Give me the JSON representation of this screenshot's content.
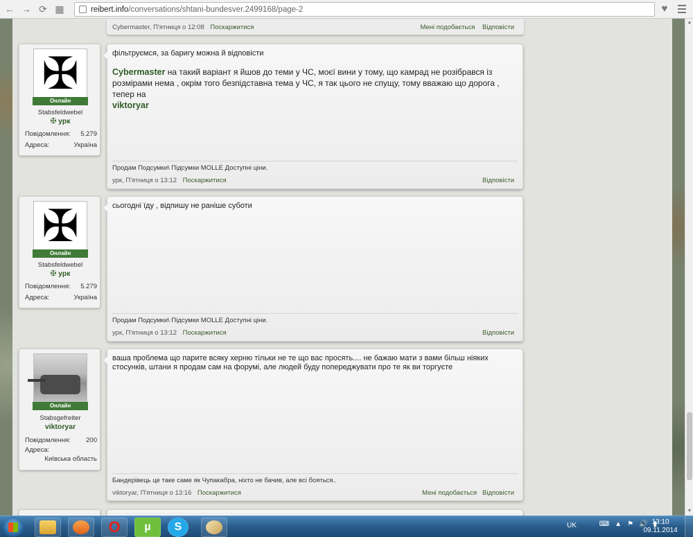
{
  "browser": {
    "back": "←",
    "forward": "→",
    "reload": "⟳",
    "apps": "▦",
    "url_host": "reibert.info",
    "url_path": "/conversations/shtani-bundesver.2499168/page-2",
    "star": "♥",
    "colors": {
      "toolbar": "#f1f1f1",
      "accent_green": "#3f7a36"
    }
  },
  "prev_footer": {
    "meta": "Cybermaster, П'ятниця о 12:08",
    "report": "Поскаржитися",
    "like": "Мені подобається",
    "reply": "Відповісти"
  },
  "messages": [
    {
      "user": {
        "avatar": "iron-cross",
        "online": "Онлайн",
        "rank": "Stabsfeldwebel",
        "name": "урк",
        "name_icon": "✠",
        "stats": [
          {
            "label": "Повідомлення:",
            "value": "5.279"
          },
          {
            "label": "Адреса:",
            "value": "Україна"
          }
        ]
      },
      "text": "фільтруємся, за баригу можна й відповісти",
      "quote_ref": "Cybermaster",
      "quote_text": " на такий варіант я йшов до теми у ЧС, моєї вини у тому, що камрад не розібрався із розмірами нема , окрім того безпідставна тема у ЧС, я так цього не спущу, тому вважаю що дорога , тепер на",
      "quote_ref2": "viktoryar",
      "signature": "Продам Подсумки\\ Підсумки MOLLE Доступні ціни.",
      "footer_meta": "урк, П'ятниця о 13:12",
      "report": "Поскаржитися",
      "reply": "Відповісти"
    },
    {
      "user": {
        "avatar": "iron-cross",
        "online": "Онлайн",
        "rank": "Stabsfeldwebel",
        "name": "урк",
        "name_icon": "✠",
        "stats": [
          {
            "label": "Повідомлення:",
            "value": "5.279"
          },
          {
            "label": "Адреса:",
            "value": "Україна"
          }
        ]
      },
      "text": "сьогодні їду , відпишу не раніше суботи",
      "signature": "Продам Подсумки\\ Підсумки MOLLE Доступні ціни.",
      "footer_meta": "урк, П'ятниця о 13:12",
      "report": "Поскаржитися",
      "reply": "Відповісти"
    },
    {
      "user": {
        "avatar": "tank-photo",
        "online": "Онлайн",
        "rank": "Stabsgefreiter",
        "name": "viktoryar",
        "stats": [
          {
            "label": "Повідомлення:",
            "value": "200"
          },
          {
            "label": "Адреса:",
            "value": ""
          },
          {
            "label": "",
            "value": "Київська область"
          }
        ]
      },
      "text": "ваша проблема що парите всяку херню тільки не те що вас просять.... не бажаю мати з вами більш ніяких стосунків, штани я продам сам на форумі, але людей буду попереджувати про те як ви торгуєте",
      "signature": "Бандерівець це таке саме як Чупакабра, ніхто не бачив, але всі бояться..",
      "footer_meta": "viktoryar, П'ятниця о 13:16",
      "report": "Поскаржитися",
      "like": "Мені подобається",
      "reply": "Відповісти"
    }
  ],
  "taskbar": {
    "apps": [
      "explorer",
      "media-player",
      "opera",
      "utorrent",
      "skype",
      "paint"
    ],
    "opera_label": "O",
    "utorrent_label": "µ",
    "skype_label": "S",
    "lang": "UK",
    "time": "13:10",
    "date": "09.11.2014"
  }
}
